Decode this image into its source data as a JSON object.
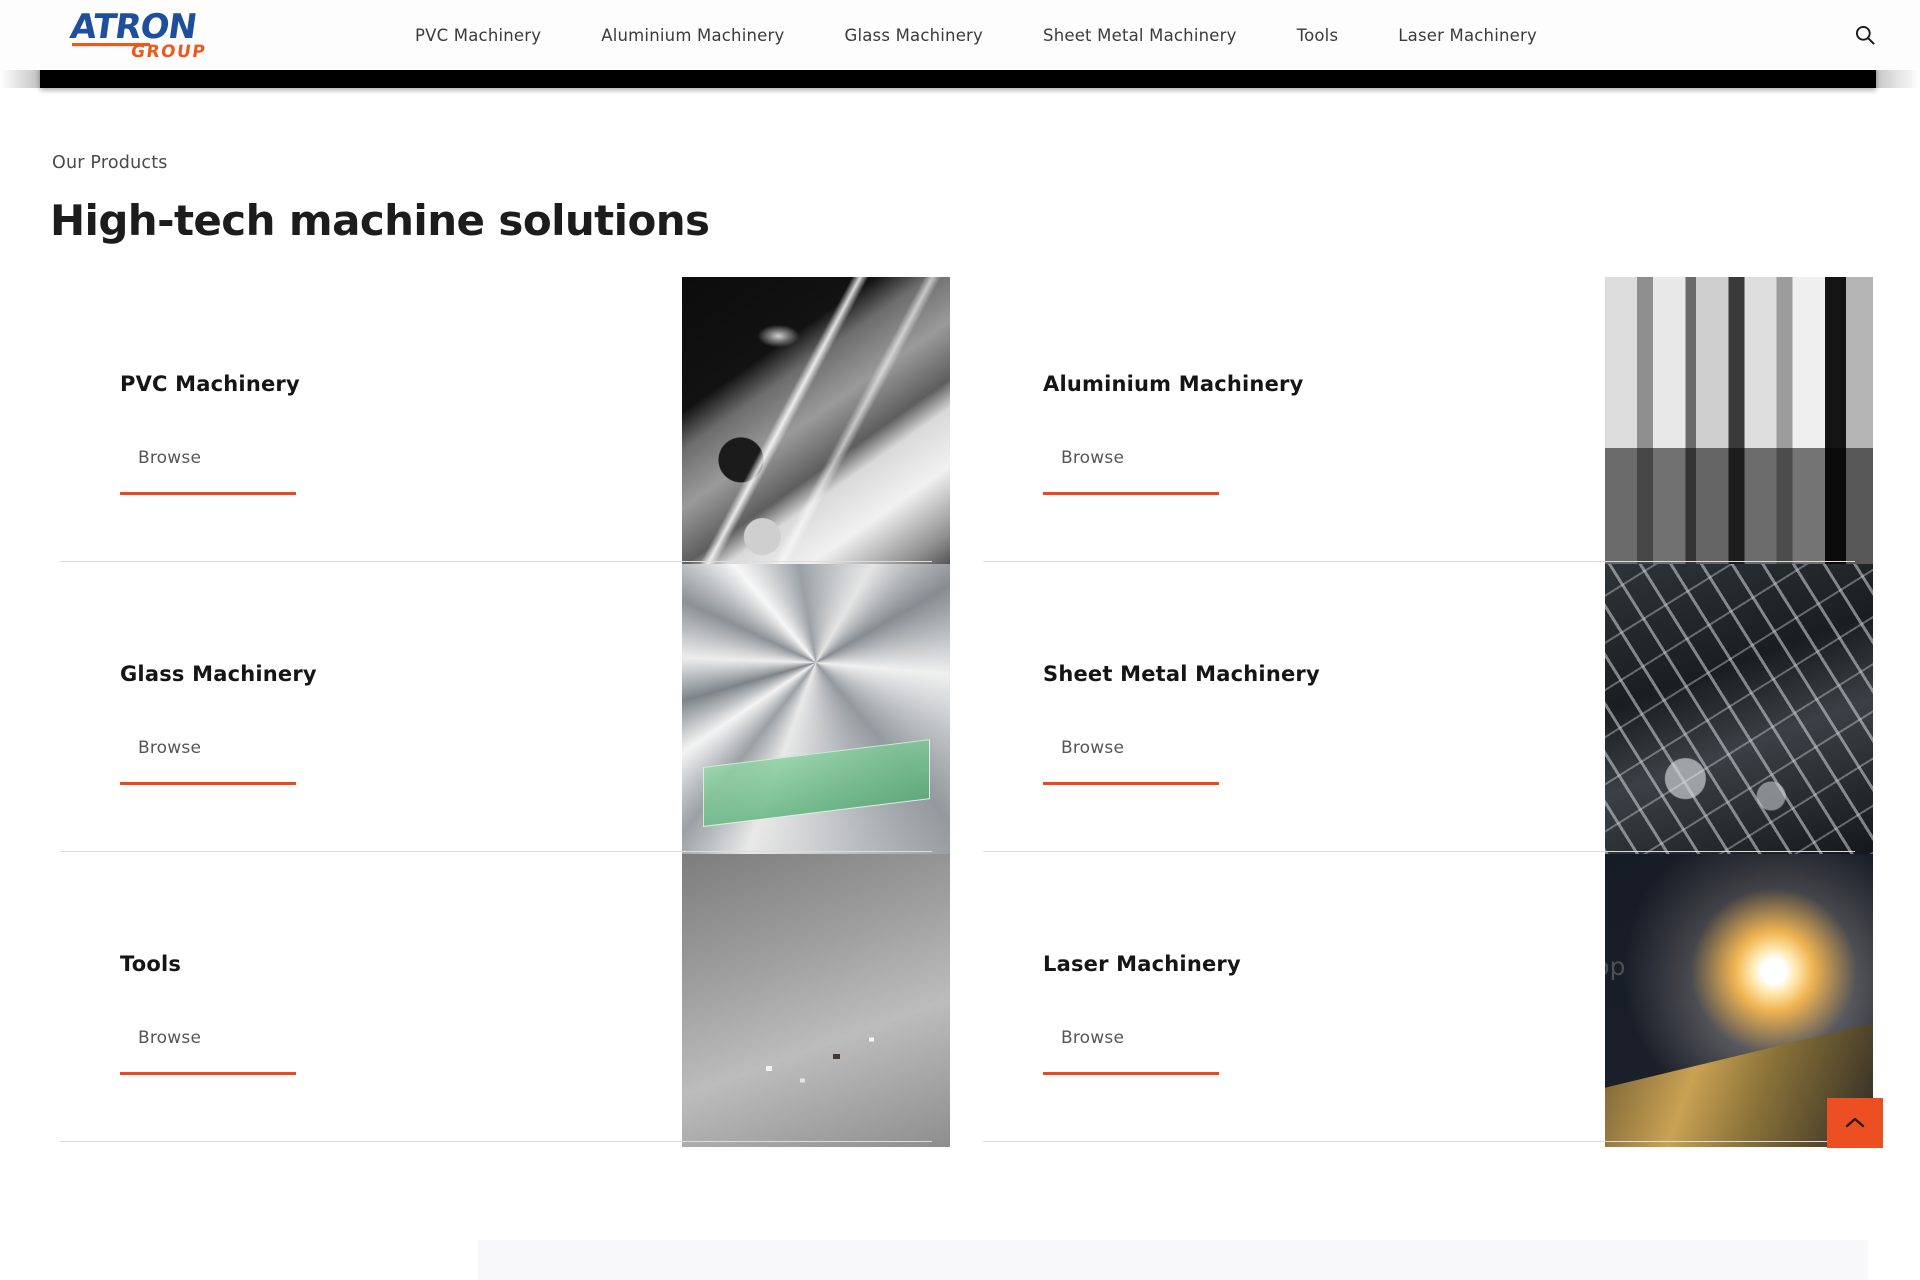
{
  "brand": {
    "name_primary": "ATRON",
    "name_secondary": "GROUP",
    "color_primary": "#1f4e9c",
    "color_accent": "#ea5a1f"
  },
  "header": {
    "nav_items": [
      {
        "label": "PVC Machinery"
      },
      {
        "label": "Aluminium Machinery"
      },
      {
        "label": "Glass Machinery"
      },
      {
        "label": "Sheet Metal Machinery"
      },
      {
        "label": "Tools"
      },
      {
        "label": "Laser Machinery"
      }
    ],
    "search_icon": "search-icon"
  },
  "section": {
    "eyebrow": "Our Products",
    "title": "High-tech machine solutions"
  },
  "products": [
    {
      "title": "PVC Machinery",
      "browse_label": "Browse",
      "image_alt": "pvc-machinery-photo"
    },
    {
      "title": "Aluminium Machinery",
      "browse_label": "Browse",
      "image_alt": "aluminium-machinery-photo"
    },
    {
      "title": "Glass Machinery",
      "browse_label": "Browse",
      "image_alt": "glass-machinery-photo"
    },
    {
      "title": "Sheet Metal Machinery",
      "browse_label": "Browse",
      "image_alt": "sheet-metal-machinery-photo"
    },
    {
      "title": "Tools",
      "browse_label": "Browse",
      "image_alt": "tools-photo"
    },
    {
      "title": "Laser Machinery",
      "browse_label": "Browse",
      "image_alt": "laser-machinery-photo",
      "watermark": "GEOM Creative Workshop"
    }
  ],
  "scroll_top": {
    "icon": "chevron-up-icon",
    "color": "#eb4f22"
  },
  "theme": {
    "accent": "#e8491f",
    "text_dark": "#151515",
    "text_muted": "#555555",
    "divider": "#dcdcdc",
    "bar": "#000000"
  }
}
